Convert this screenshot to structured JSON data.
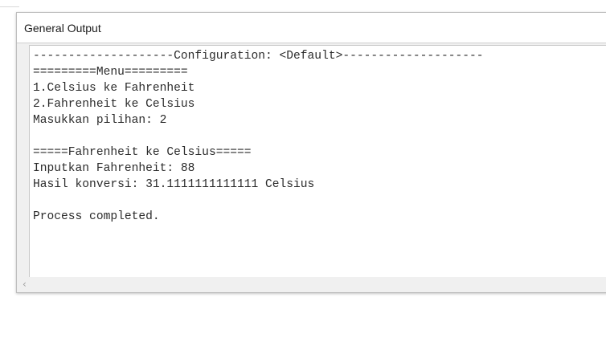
{
  "window": {
    "title": "General Output"
  },
  "output": {
    "lines": [
      "--------------------Configuration: <Default>--------------------",
      "=========Menu=========",
      "1.Celsius ke Fahrenheit",
      "2.Fahrenheit ke Celsius",
      "Masukkan pilihan: 2",
      "",
      "=====Fahrenheit ke Celsius=====",
      "Inputkan Fahrenheit: 88",
      "Hasil konversi: 31.1111111111111 Celsius",
      "",
      "Process completed."
    ]
  },
  "scrollbar": {
    "left_arrow_icon": "chevron-left-icon",
    "left_arrow_glyph": "‹"
  }
}
